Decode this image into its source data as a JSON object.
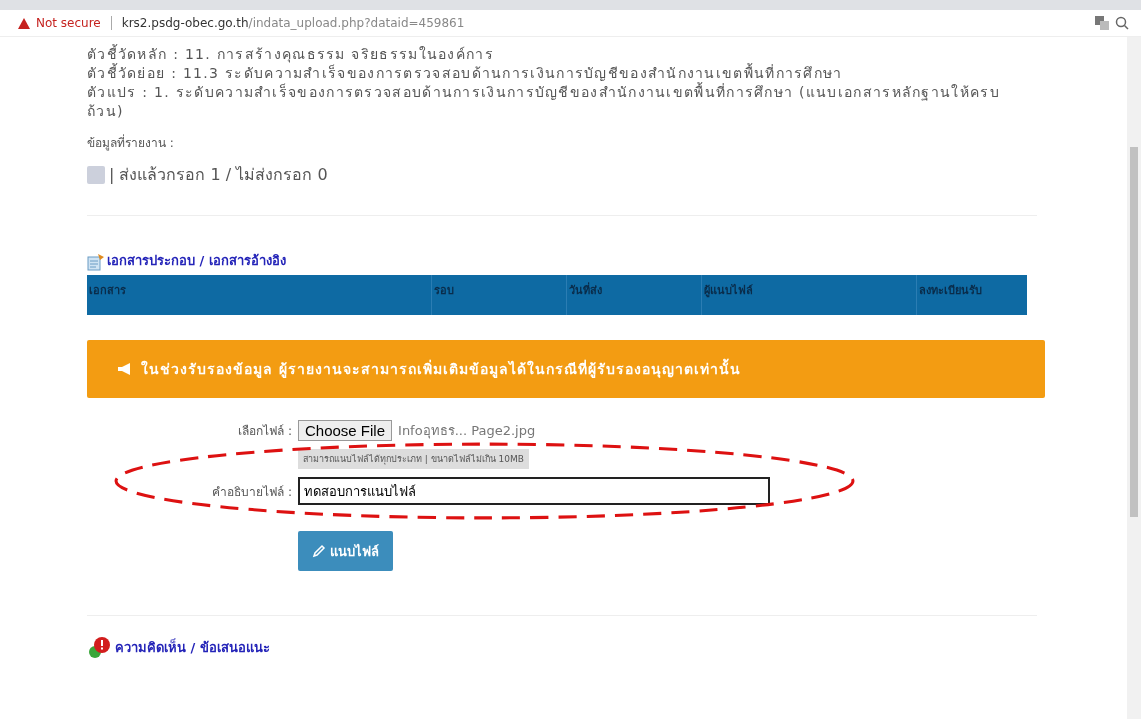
{
  "browser": {
    "security": "Not secure",
    "url_host": "krs2.psdg-obec.go.th",
    "url_path": "/indata_upload.php?dataid=459861"
  },
  "indicator_lines": [
    {
      "label": "ตัวชี้วัดหลัก :",
      "text": "11. การสร้างคุณธรรม จริยธรรมในองค์การ"
    },
    {
      "label": "ตัวชี้วัดย่อย :",
      "text": "11.3 ระดับความสำเร็จของการตรวจสอบด้านการเงินการบัญชีของสำนักงานเขตพื้นที่การศึกษา"
    },
    {
      "label": "ตัวแปร :",
      "text": "1. ระดับความสำเร็จของการตรวจสอบด้านการเงินการบัญชีของสำนักงานเขตพื้นที่การศึกษา (แนบเอกสารหลักฐานให้ครบถ้วน)"
    }
  ],
  "report_label": "ข้อมูลที่รายงาน :",
  "report_status": {
    "color": "#ccd0dc",
    "text": "| ส่งแล้วกรอก 1 / ไม่ส่งกรอก 0"
  },
  "documents": {
    "title": "เอกสารประกอบ / เอกสารอ้างอิง",
    "columns": [
      "เอกสาร",
      "รอบ",
      "วันที่ส่ง",
      "ผู้แนบไฟล์",
      "ลงทะเบียนรับ"
    ]
  },
  "alert": "ในช่วงรับรองข้อมูล ผู้รายงานจะสามารถเพิ่มเติมข้อมูลได้ในกรณีที่ผู้รับรองอนุญาตเท่านั้น",
  "upload": {
    "file_label": "เลือกไฟล์ :",
    "choose_button": "Choose File",
    "file_name": "Infoอุทธร... Page2.jpg",
    "hint": "สามารถแนบไฟล์ได้ทุกประเภท | ขนาดไฟล์ไม่เกิน 10MB",
    "description_label": "คำอธิบายไฟล์ :",
    "description_value": "ทดสอบการแนบไฟล์",
    "submit": "แนบไฟล์"
  },
  "comments": {
    "title": "ความคิดเห็น / ข้อเสนอแนะ"
  }
}
